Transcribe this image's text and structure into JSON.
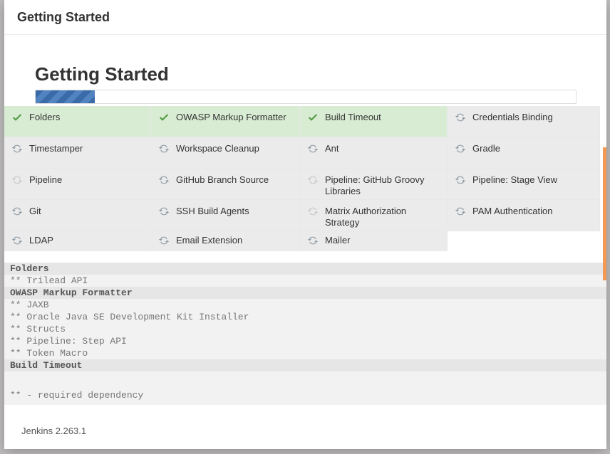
{
  "header": {
    "title": "Getting Started"
  },
  "inner_title": "Getting Started",
  "progress_pct": 11,
  "plugins": [
    {
      "name": "Folders",
      "state": "done"
    },
    {
      "name": "OWASP Markup Formatter",
      "state": "done"
    },
    {
      "name": "Build Timeout",
      "state": "done"
    },
    {
      "name": "Credentials Binding",
      "state": "spin"
    },
    {
      "name": "Timestamper",
      "state": "spin"
    },
    {
      "name": "Workspace Cleanup",
      "state": "spin"
    },
    {
      "name": "Ant",
      "state": "spin"
    },
    {
      "name": "Gradle",
      "state": "spin"
    },
    {
      "name": "Pipeline",
      "state": "spin-pale"
    },
    {
      "name": "GitHub Branch Source",
      "state": "spin"
    },
    {
      "name": "Pipeline: GitHub Groovy Libraries",
      "state": "spin-pale"
    },
    {
      "name": "Pipeline: Stage View",
      "state": "spin"
    },
    {
      "name": "Git",
      "state": "spin"
    },
    {
      "name": "SSH Build Agents",
      "state": "spin"
    },
    {
      "name": "Matrix Authorization Strategy",
      "state": "spin-pale"
    },
    {
      "name": "PAM Authentication",
      "state": "spin"
    },
    {
      "name": "LDAP",
      "state": "spin"
    },
    {
      "name": "Email Extension",
      "state": "spin"
    },
    {
      "name": "Mailer",
      "state": "spin"
    }
  ],
  "log": [
    {
      "type": "section",
      "text": "Folders"
    },
    {
      "type": "dep",
      "text": "** Trilead API"
    },
    {
      "type": "section",
      "text": "OWASP Markup Formatter"
    },
    {
      "type": "dep",
      "text": "** JAXB"
    },
    {
      "type": "dep",
      "text": "** Oracle Java SE Development Kit Installer"
    },
    {
      "type": "dep",
      "text": "** Structs"
    },
    {
      "type": "dep",
      "text": "** Pipeline: Step API"
    },
    {
      "type": "dep",
      "text": "** Token Macro"
    },
    {
      "type": "section",
      "text": "Build Timeout"
    }
  ],
  "footer_note": "** - required dependency",
  "version": "Jenkins 2.263.1"
}
